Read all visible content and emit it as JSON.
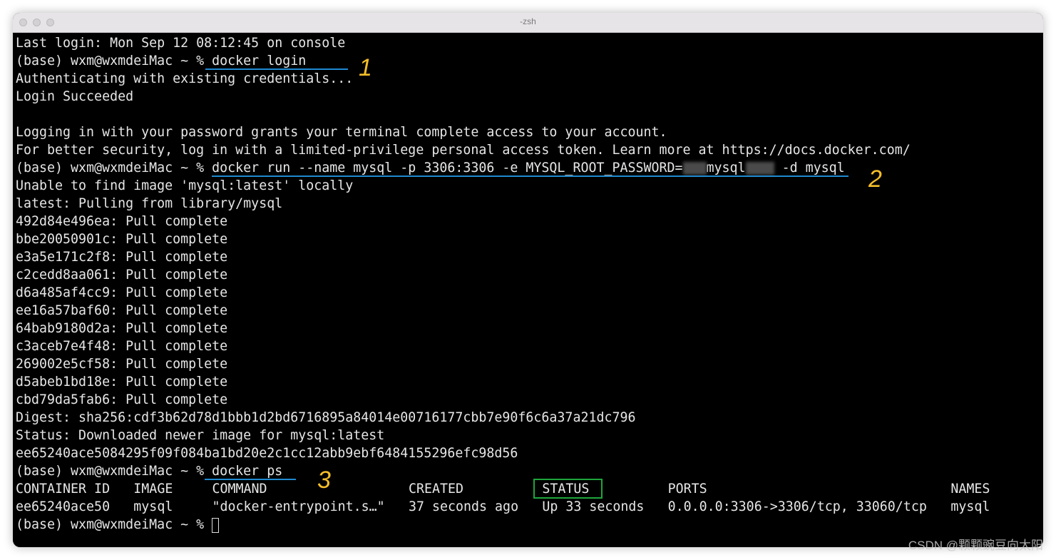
{
  "window": {
    "title": "-zsh"
  },
  "terminal": {
    "lines": [
      "Last login: Mon Sep 12 08:12:45 on console",
      "(base) wxm@wxmdeiMac ~ % docker login",
      "Authenticating with existing credentials...",
      "Login Succeeded",
      "",
      "Logging in with your password grants your terminal complete access to your account.",
      "For better security, log in with a limited-privilege personal access token. Learn more at https://docs.docker.com/"
    ],
    "run_command": {
      "prefix": "(base) wxm@wxmdeiMac ~ % docker run --name mysql -p 3306:3306 -e MYSQL_ROOT_PASSWORD=",
      "middle": "mysql",
      "suffix": " -d mysql"
    },
    "pull_lines": [
      "Unable to find image 'mysql:latest' locally",
      "latest: Pulling from library/mysql",
      "492d84e496ea: Pull complete",
      "bbe20050901c: Pull complete",
      "e3a5e171c2f8: Pull complete",
      "c2cedd8aa061: Pull complete",
      "d6a485af4cc9: Pull complete",
      "ee16a57baf60: Pull complete",
      "64bab9180d2a: Pull complete",
      "c3aceb7e4f48: Pull complete",
      "269002e5cf58: Pull complete",
      "d5abeb1bd18e: Pull complete",
      "cbd79da5fab6: Pull complete",
      "Digest: sha256:cdf3b62d78d1bbb1d2bd6716895a84014e00716177cbb7e90f6c6a37a21dc796",
      "Status: Downloaded newer image for mysql:latest",
      "ee65240ace5084295f09f084ba1bd20e2c1cc12abb9ebf6484155296efc98d56",
      "(base) wxm@wxmdeiMac ~ % docker ps"
    ],
    "ps_table": {
      "headers": [
        "CONTAINER ID",
        "IMAGE",
        "COMMAND",
        "CREATED",
        "STATUS",
        "PORTS",
        "NAMES"
      ],
      "rows": [
        [
          "ee65240ace50",
          "mysql",
          "\"docker-entrypoint.s…\"",
          "37 seconds ago",
          "Up 33 seconds",
          "0.0.0.0:3306->3306/tcp, 33060/tcp",
          "mysql"
        ]
      ]
    },
    "prompt": "(base) wxm@wxmdeiMac ~ % "
  },
  "annotations": {
    "numbers": [
      "1",
      "2",
      "3"
    ],
    "underline_color": "#1f8ad1",
    "number_color": "#f4bd2a",
    "highlight_box_color": "#1ea53c"
  },
  "watermark": "CSDN @颗颗豌豆向太阳"
}
